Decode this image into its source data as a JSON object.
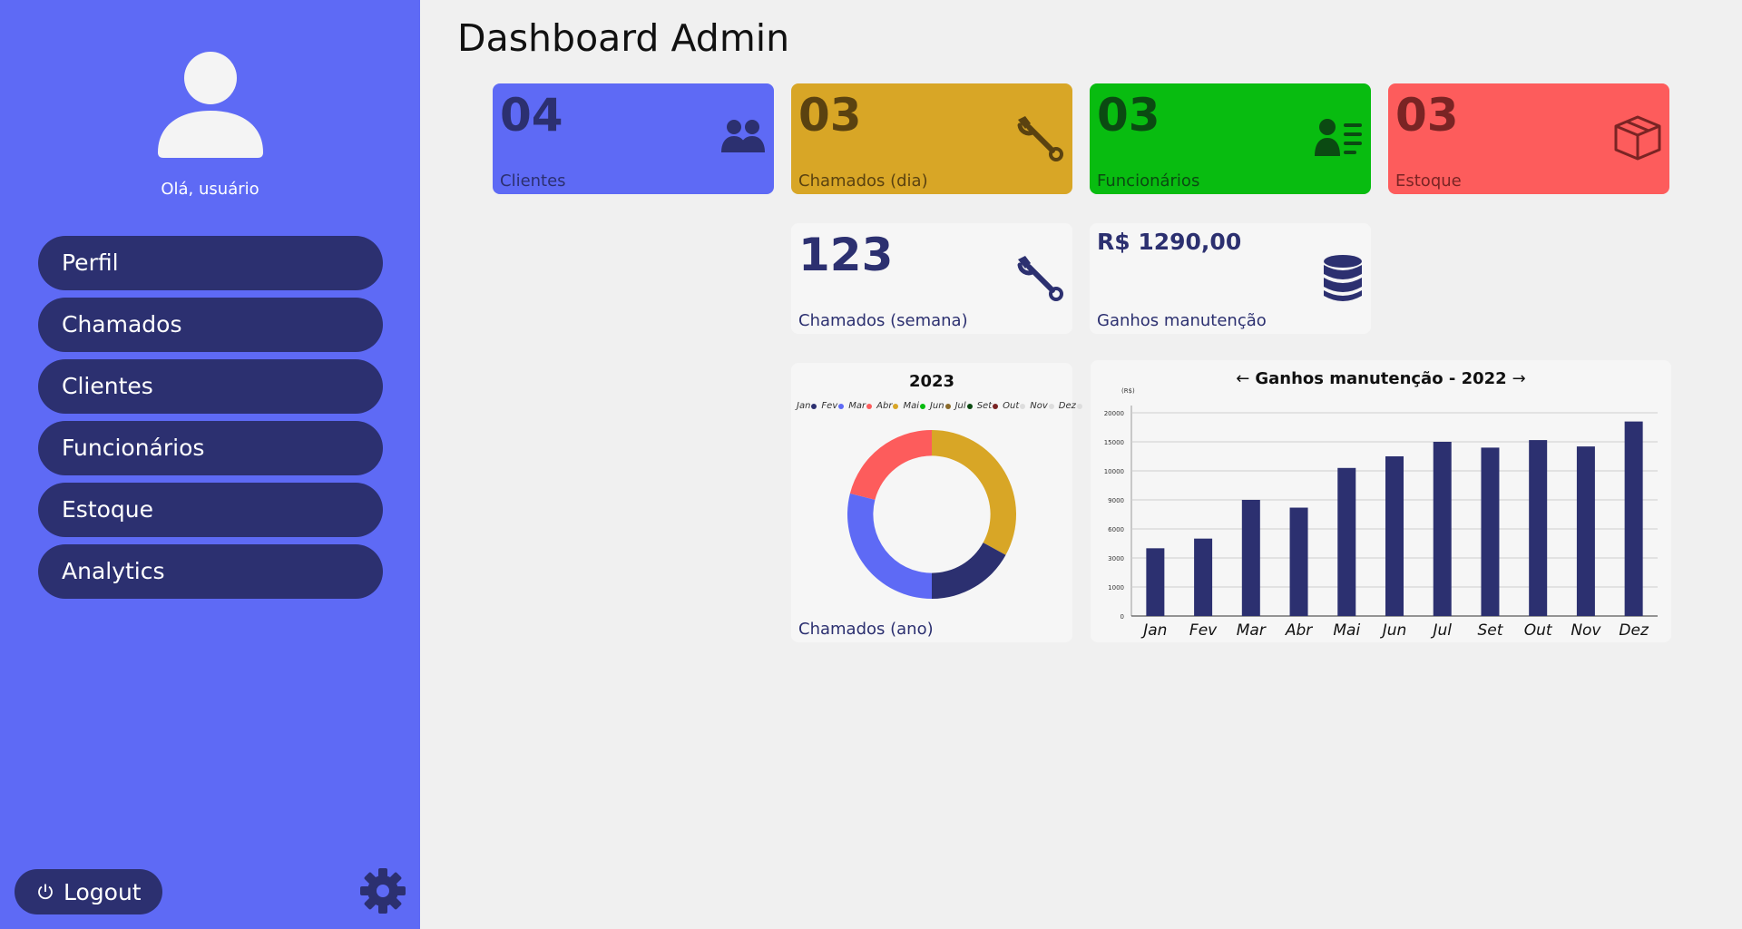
{
  "sidebar": {
    "greeting": "Olá, usuário",
    "nav": [
      "Perfil",
      "Chamados",
      "Clientes",
      "Funcionários",
      "Estoque",
      "Analytics"
    ],
    "logout_label": "Logout"
  },
  "page_title": "Dashboard Admin",
  "cards": {
    "clientes": {
      "value": "04",
      "label": "Clientes",
      "icon": "users-icon"
    },
    "chamados_dia": {
      "value": "03",
      "label": "Chamados (dia)",
      "icon": "wrench-icon"
    },
    "funcionarios": {
      "value": "03",
      "label": "Funcionários",
      "icon": "employee-list-icon"
    },
    "estoque": {
      "value": "03",
      "label": "Estoque",
      "icon": "box-icon"
    },
    "chamados_semana": {
      "value": "123",
      "label": "Chamados (semana)",
      "icon": "wrench-icon"
    },
    "ganhos": {
      "value": "R$ 1290,00",
      "label": "Ganhos manutenção",
      "icon": "database-icon"
    }
  },
  "colors": {
    "sidebar": "#5e6af5",
    "nav": "#2c3070",
    "clientes": "#5e6af5",
    "chamados": "#d8a626",
    "funcionarios": "#08bc10",
    "estoque": "#fd5c5c"
  },
  "chart_data": [
    {
      "type": "pie",
      "title": "2023",
      "caption": "Chamados (ano)",
      "legend": [
        {
          "label": "Jan",
          "color": "#2c3070"
        },
        {
          "label": "Fev",
          "color": "#5e6af5"
        },
        {
          "label": "Mar",
          "color": "#fd5c5c"
        },
        {
          "label": "Abr",
          "color": "#d8a626"
        },
        {
          "label": "Mai",
          "color": "#08bc10"
        },
        {
          "label": "Jun",
          "color": "#8a6a2a"
        },
        {
          "label": "Jul",
          "color": "#0b4a12"
        },
        {
          "label": "Set",
          "color": "#7a2424"
        },
        {
          "label": "Out",
          "color": "#dddddd"
        },
        {
          "label": "Nov",
          "color": "#dddddd"
        },
        {
          "label": "Dez",
          "color": "#dddddd"
        }
      ],
      "slices": [
        {
          "label": "Abr",
          "value": 33,
          "color": "#d8a626"
        },
        {
          "label": "Jan",
          "value": 17,
          "color": "#2c3070"
        },
        {
          "label": "Fev",
          "value": 29,
          "color": "#5e6af5"
        },
        {
          "label": "Mar",
          "value": 21,
          "color": "#fd5c5c"
        }
      ]
    },
    {
      "type": "bar",
      "title": "Ganhos manutenção - 2022",
      "ylabel": "(R$)",
      "categories": [
        "Jan",
        "Fev",
        "Mar",
        "Abr",
        "Mai",
        "Jun",
        "Jul",
        "Set",
        "Out",
        "Nov",
        "Dez"
      ],
      "values": [
        4000,
        5000,
        9000,
        8200,
        10500,
        12500,
        15000,
        14000,
        15300,
        14200,
        18500
      ],
      "yticks": [
        "0",
        "1000",
        "3000",
        "6000",
        "9000",
        "10000",
        "15000",
        "20000"
      ],
      "bar_color": "#2c3070"
    }
  ]
}
